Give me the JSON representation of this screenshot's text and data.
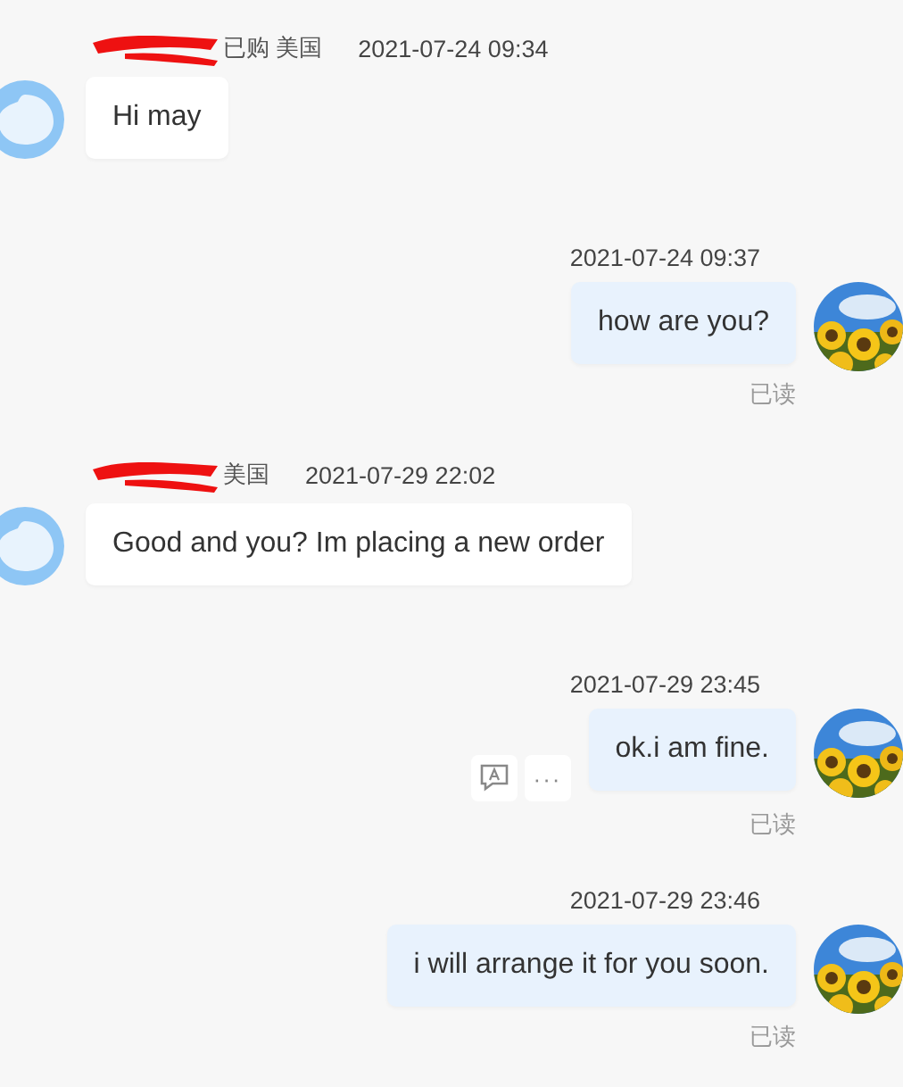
{
  "messages": [
    {
      "kind": "incoming",
      "meta": "已购 美国",
      "time": "2021-07-24 09:34",
      "text": "Hi may"
    },
    {
      "kind": "outgoing",
      "time": "2021-07-24 09:37",
      "text": "how are you?",
      "status": "已读",
      "actions": false
    },
    {
      "kind": "incoming",
      "meta": "美国",
      "time": "2021-07-29 22:02",
      "text": "Good and you? Im placing a new order"
    },
    {
      "kind": "outgoing",
      "time": "2021-07-29 23:45",
      "text": "ok.i am fine.",
      "status": "已读",
      "actions": true,
      "more": "···"
    },
    {
      "kind": "outgoing",
      "time": "2021-07-29 23:46",
      "text": "i will arrange it for you soon.",
      "status": "已读",
      "actions": false
    }
  ]
}
